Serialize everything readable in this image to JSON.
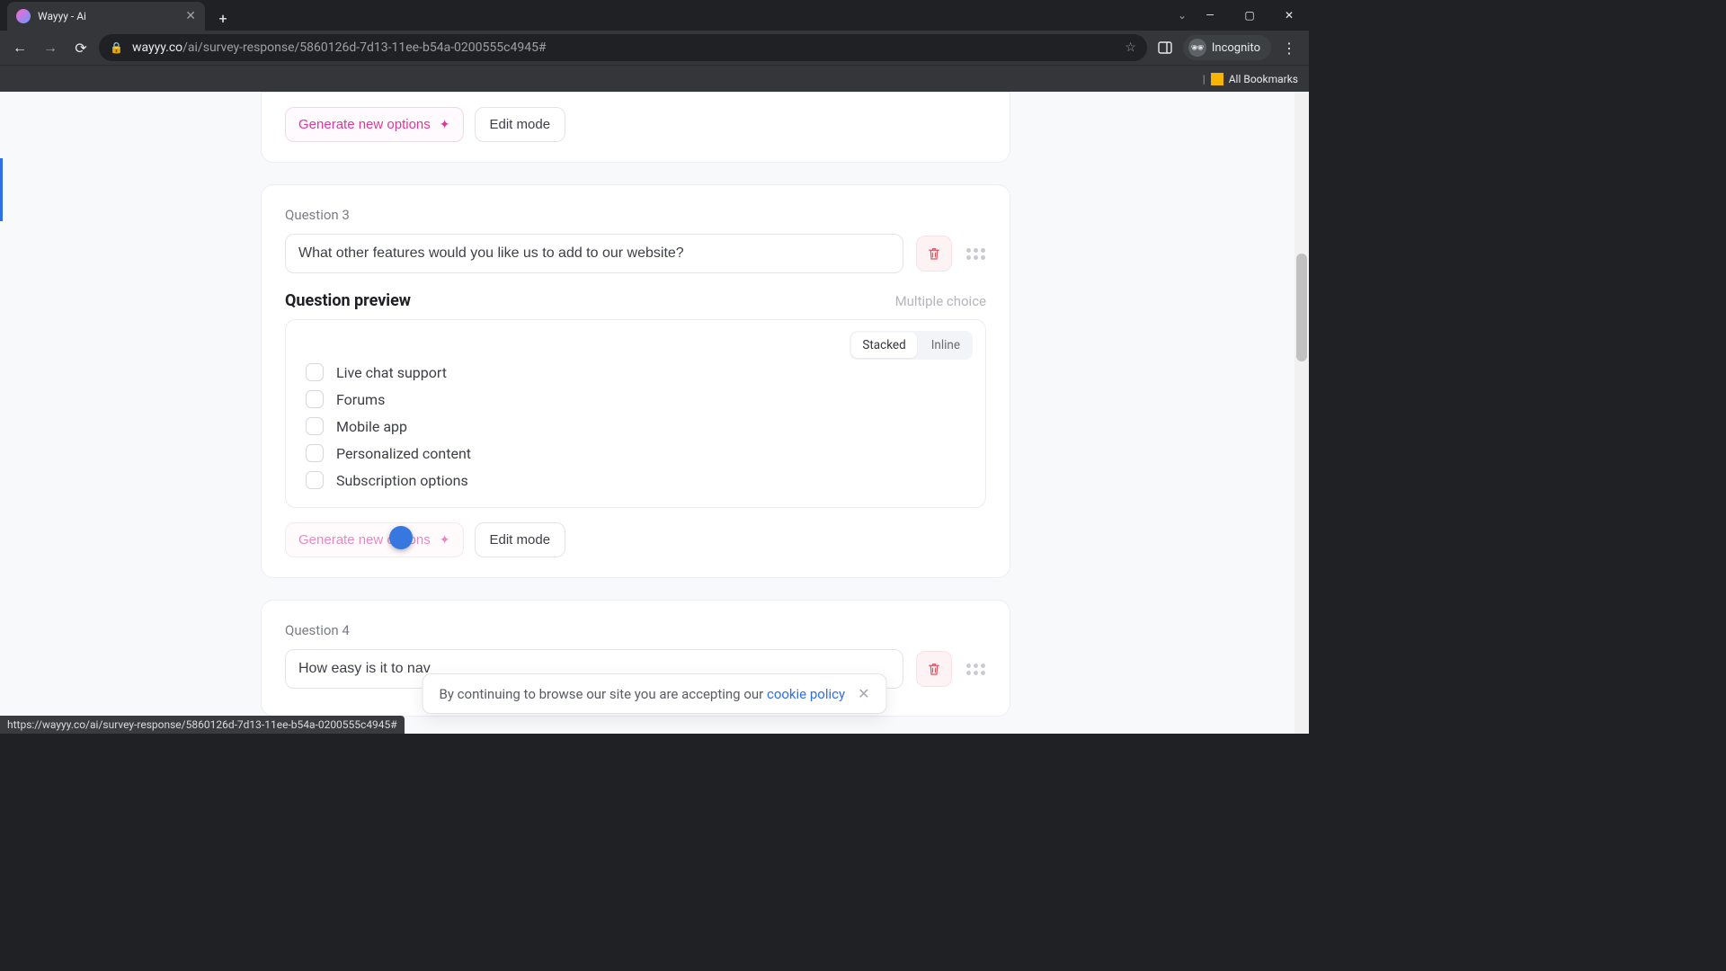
{
  "browser": {
    "tab_title": "Wayyy - Ai",
    "url_host": "wayyy.co",
    "url_path": "/ai/survey-response/5860126d-7d13-11ee-b54a-0200555c4945#",
    "incognito_label": "Incognito",
    "all_bookmarks": "All Bookmarks",
    "status_link": "https://wayyy.co/ai/survey-response/5860126d-7d13-11ee-b54a-0200555c4945#"
  },
  "ui": {
    "generate_btn": "Generate new options",
    "edit_btn": "Edit mode",
    "preview_title": "Question preview",
    "stacked": "Stacked",
    "inline": "Inline",
    "multiple_choice": "Multiple choice"
  },
  "q3": {
    "label": "Question 3",
    "text": "What other features would you like us to add to our website?",
    "options": [
      "Live chat support",
      "Forums",
      "Mobile app",
      "Personalized content",
      "Subscription options"
    ]
  },
  "q4": {
    "label": "Question 4",
    "text_visible": "How easy is it to nav"
  },
  "cookie": {
    "text": "By continuing to browse our site you are accepting our ",
    "link": "cookie policy"
  }
}
